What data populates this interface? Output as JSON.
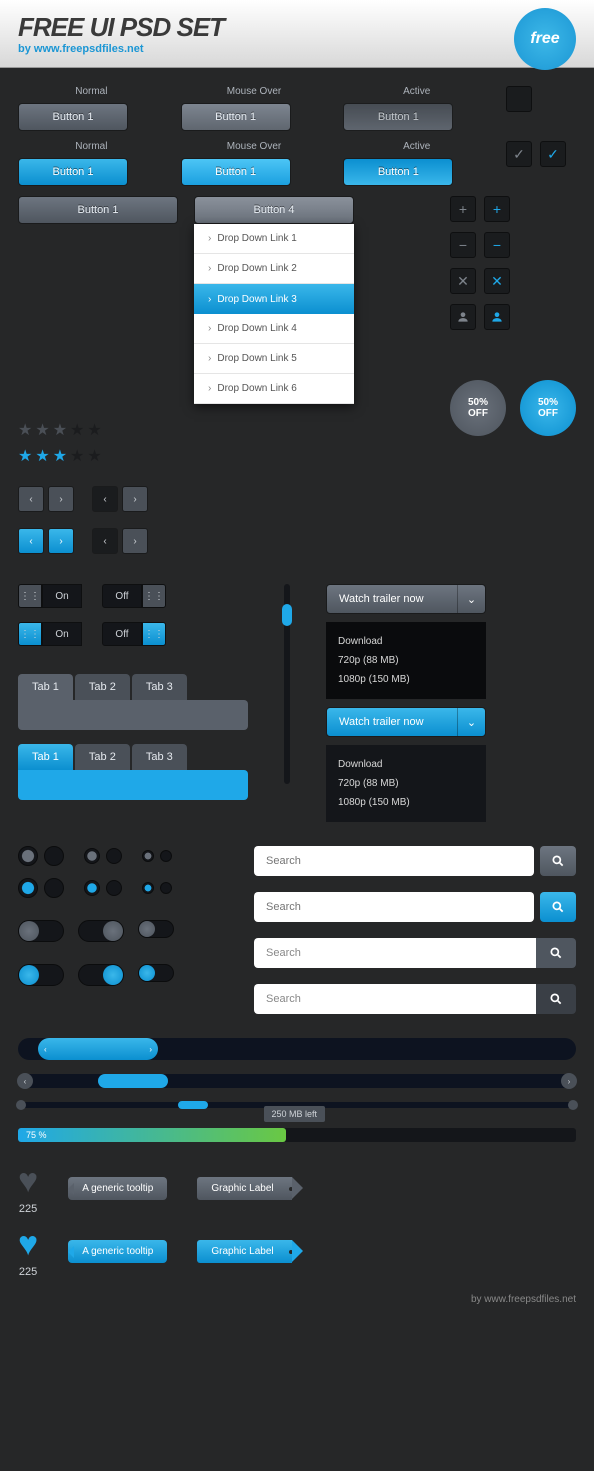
{
  "header": {
    "title": "FREE UI PSD SET",
    "subtitle": "by www.freepsdfiles.net",
    "badge": "free"
  },
  "states": {
    "normal": "Normal",
    "mouseover": "Mouse Over",
    "active": "Active"
  },
  "buttons": {
    "gray": "Button 1",
    "blue": "Button 1",
    "wide1": "Button 1",
    "wide4": "Button 4"
  },
  "dropdown": {
    "items": [
      "Drop Down Link 1",
      "Drop Down Link 2",
      "Drop Down Link 3",
      "Drop Down Link 4",
      "Drop Down Link 5",
      "Drop Down Link 6"
    ]
  },
  "seal": {
    "line1": "50%",
    "line2": "OFF"
  },
  "toggle": {
    "on": "On",
    "off": "Off"
  },
  "tabs": {
    "t1": "Tab 1",
    "t2": "Tab 2",
    "t3": "Tab 3"
  },
  "trailer": {
    "label": "Watch trailer now",
    "download": "Download",
    "q720": "720p (88 MB)",
    "q1080": "1080p (150 MB)"
  },
  "search": {
    "placeholder": "Search"
  },
  "progress": {
    "pct": "75 %",
    "remaining": "250 MB left"
  },
  "heart": {
    "count": "225"
  },
  "tooltip": {
    "text": "A generic tooltip"
  },
  "tag": {
    "text": "Graphic Label"
  },
  "footer": "by www.freepsdfiles.net"
}
